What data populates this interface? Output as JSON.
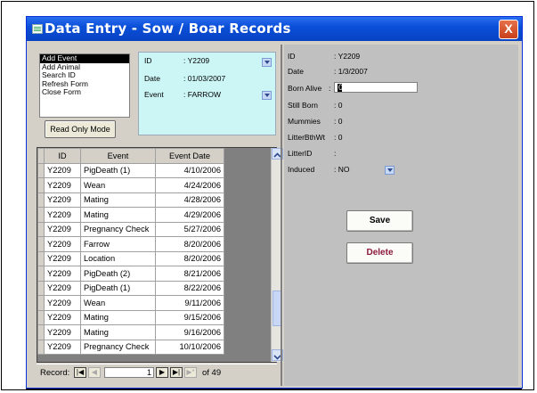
{
  "window": {
    "title": "Data Entry - Sow / Boar Records",
    "close_label": "X"
  },
  "menu": {
    "items": [
      "Add Event",
      "Add Animal",
      "Search ID",
      "Refresh Form",
      "Close Form"
    ],
    "selected_index": 0
  },
  "read_only_button": "Read Only Mode",
  "info": {
    "id_label": "ID",
    "id_value": ": Y2209",
    "date_label": "Date",
    "date_value": ": 01/03/2007",
    "event_label": "Event",
    "event_value": ": FARROW"
  },
  "grid": {
    "columns": [
      "ID",
      "Event",
      "Event Date"
    ],
    "rows": [
      [
        "Y2209",
        "PigDeath (1)",
        "4/10/2006"
      ],
      [
        "Y2209",
        "Wean",
        "4/24/2006"
      ],
      [
        "Y2209",
        "Mating",
        "4/28/2006"
      ],
      [
        "Y2209",
        "Mating",
        "4/29/2006"
      ],
      [
        "Y2209",
        "Pregnancy Check",
        "5/27/2006"
      ],
      [
        "Y2209",
        "Farrow",
        "8/20/2006"
      ],
      [
        "Y2209",
        "Location",
        "8/20/2006"
      ],
      [
        "Y2209",
        "PigDeath (2)",
        "8/21/2006"
      ],
      [
        "Y2209",
        "PigDeath (1)",
        "8/22/2006"
      ],
      [
        "Y2209",
        "Wean",
        "9/11/2006"
      ],
      [
        "Y2209",
        "Mating",
        "9/15/2006"
      ],
      [
        "Y2209",
        "Mating",
        "9/16/2006"
      ],
      [
        "Y2209",
        "Pregnancy Check",
        "10/10/2006"
      ]
    ]
  },
  "nav": {
    "record_label": "Record:",
    "current": "1",
    "total": "of 49"
  },
  "detail": {
    "id_label": "ID",
    "id_value": ": Y2209",
    "date_label": "Date",
    "date_value": ": 1/3/2007",
    "born_alive_label": "Born Alive",
    "born_alive_colon": ":",
    "born_alive_value": "0",
    "still_born_label": "Still Born",
    "still_born_value": ": 0",
    "mummies_label": "Mummies",
    "mummies_value": ": 0",
    "litter_bth_wt_label": "LitterBthWt",
    "litter_bth_wt_value": ": 0",
    "litter_id_label": "LitterID",
    "litter_id_value": ":",
    "induced_label": "Induced",
    "induced_value": ": NO"
  },
  "buttons": {
    "save": "Save",
    "delete": "Delete"
  },
  "colors": {
    "title_bar": "#0a4fd8",
    "info_bg": "#ccf5f5",
    "delete_text": "#8b1a3c",
    "panel": "#d4d0c8"
  }
}
